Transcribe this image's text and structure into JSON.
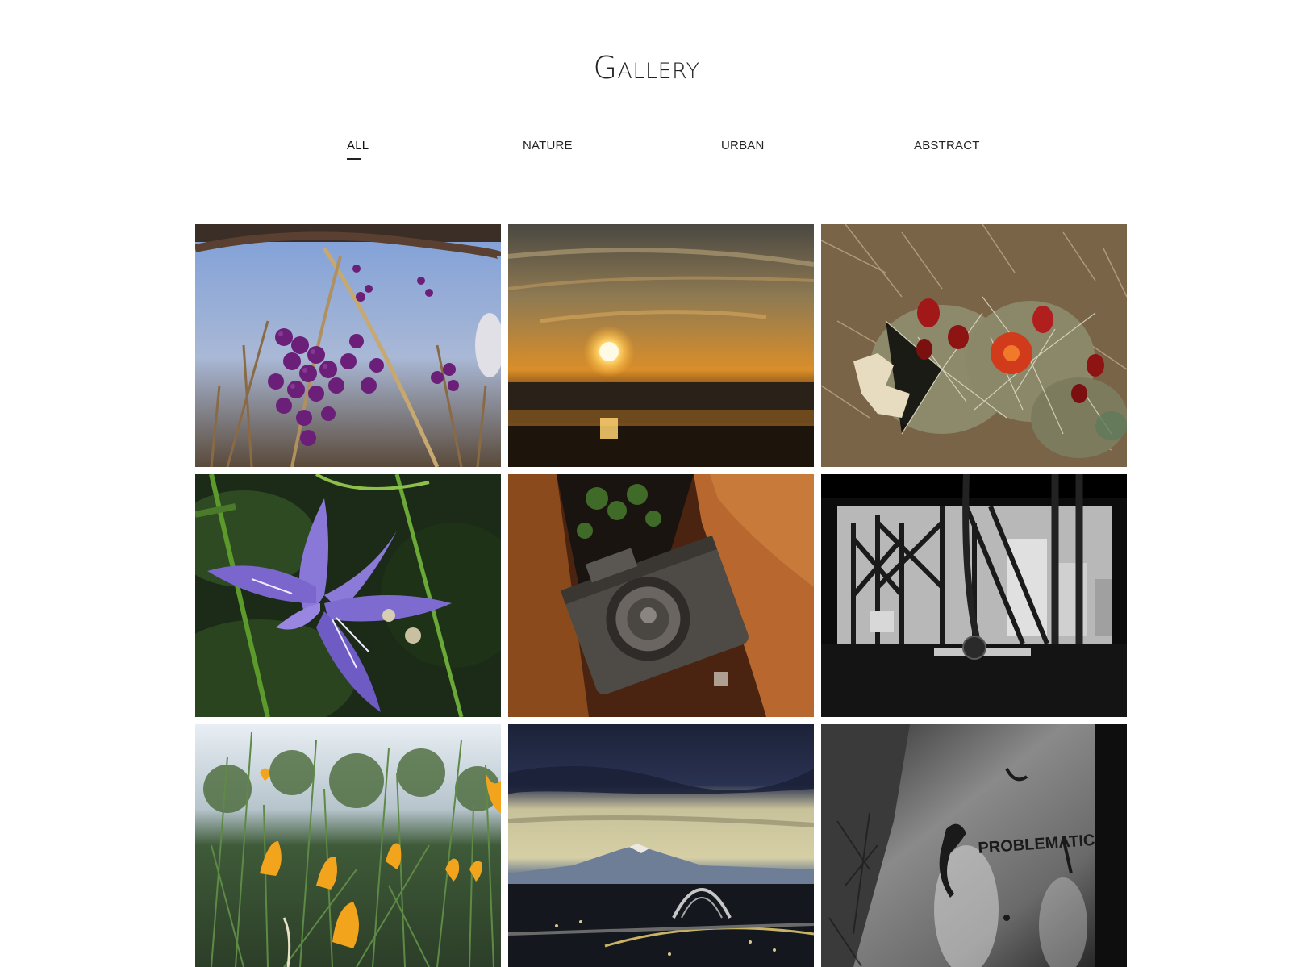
{
  "page": {
    "title": "Gallery"
  },
  "filters": {
    "active": "ALL",
    "tabs": [
      {
        "label": "ALL"
      },
      {
        "label": "NATURE"
      },
      {
        "label": "URBAN"
      },
      {
        "label": "ABSTRACT"
      }
    ]
  },
  "photos": [
    {
      "subject": "purple-berries",
      "category": "nature"
    },
    {
      "subject": "ocean-sunset",
      "category": "nature"
    },
    {
      "subject": "cactus-flowers",
      "category": "nature"
    },
    {
      "subject": "purple-iris",
      "category": "nature"
    },
    {
      "subject": "rusty-camera",
      "category": "abstract"
    },
    {
      "subject": "bridge-interior-bw",
      "category": "urban"
    },
    {
      "subject": "orange-poppies",
      "category": "nature"
    },
    {
      "subject": "mountain-bridge-dusk",
      "category": "urban"
    },
    {
      "subject": "graffiti-wall-bw",
      "category": "abstract"
    }
  ],
  "colors": {
    "background": "#ffffff",
    "text": "#222222"
  }
}
